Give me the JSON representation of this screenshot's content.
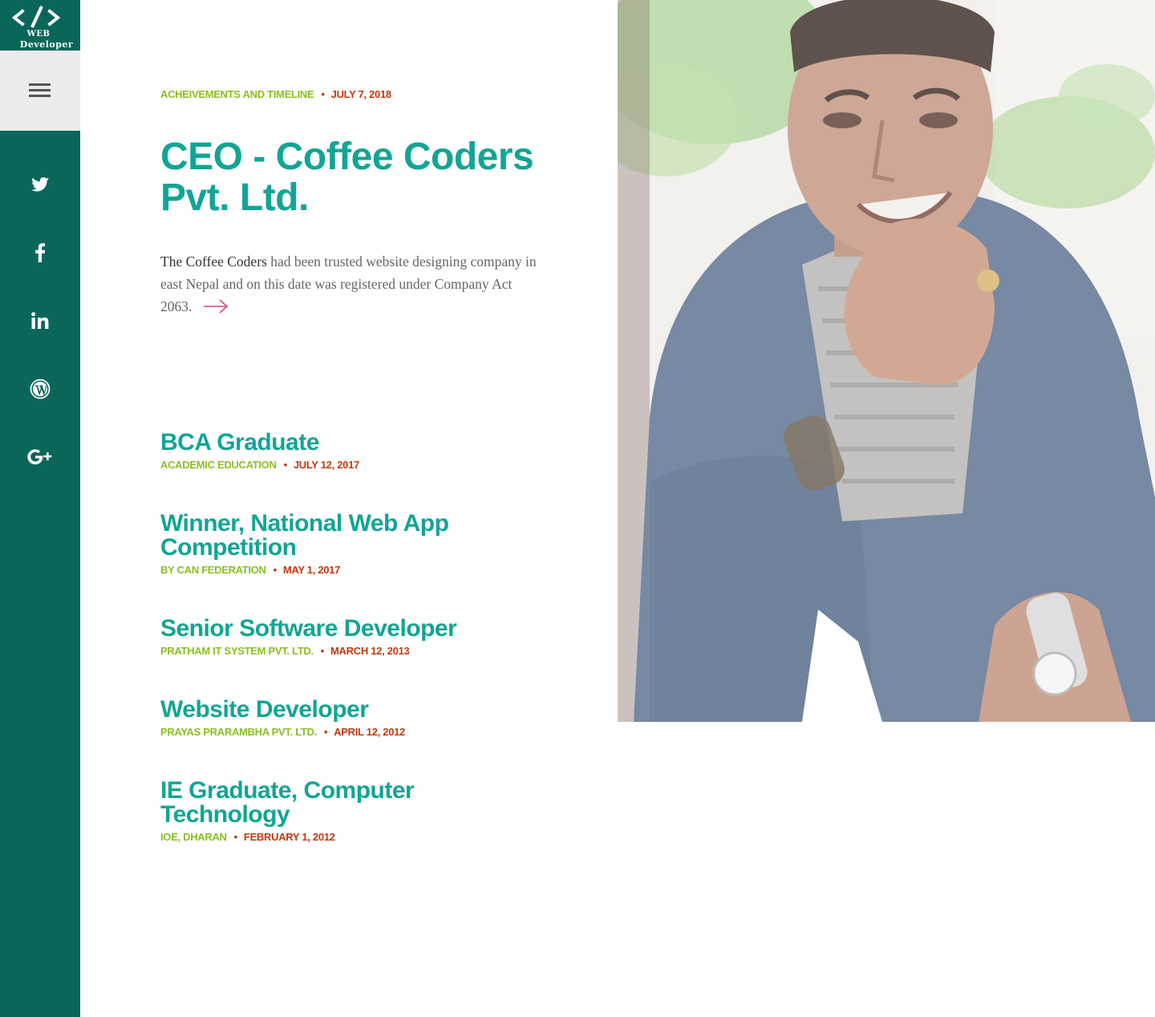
{
  "logo": {
    "line1": "WEB",
    "line2": "Developer"
  },
  "menu": {
    "icon": "hamburger-icon"
  },
  "social": [
    {
      "name": "twitter",
      "icon": "twitter-icon"
    },
    {
      "name": "facebook",
      "icon": "facebook-icon"
    },
    {
      "name": "linkedin",
      "icon": "linkedin-icon"
    },
    {
      "name": "wordpress",
      "icon": "wordpress-icon"
    },
    {
      "name": "google-plus",
      "icon": "google-plus-icon"
    }
  ],
  "featured": {
    "category": "ACHEIVEMENTS AND TIMELINE",
    "date": "JULY 7, 2018",
    "title": "CEO - Coffee Coders Pvt. Ltd.",
    "excerpt_strong": "The Coffee Coders",
    "excerpt_rest": " had been trusted website designing company in east Nepal and on this date was registered under Company Act 2063.",
    "read_more_icon": "arrow-right-icon"
  },
  "timeline": [
    {
      "title": "BCA Graduate",
      "category": "ACADEMIC EDUCATION",
      "date": "JULY 12, 2017"
    },
    {
      "title": "Winner, National Web App Competition",
      "category": "BY CAN FEDERATION",
      "date": "MAY 1, 2017"
    },
    {
      "title": "Senior Software Developer",
      "category": "PRATHAM IT SYSTEM PVT. LTD.",
      "date": "MARCH 12, 2013"
    },
    {
      "title": "Website Developer",
      "category": "PRAYAS PRARAMBHA PVT. LTD.",
      "date": "APRIL 12, 2012"
    },
    {
      "title": "IE Graduate, Computer Technology",
      "category": "IOE, DHARAN",
      "date": "FEBRUARY 1, 2012"
    }
  ],
  "colors": {
    "sidebar": "#0a6659",
    "title": "#11a595",
    "category": "#8bbf20",
    "date": "#c33a0c",
    "arrow": "#e0457b"
  }
}
